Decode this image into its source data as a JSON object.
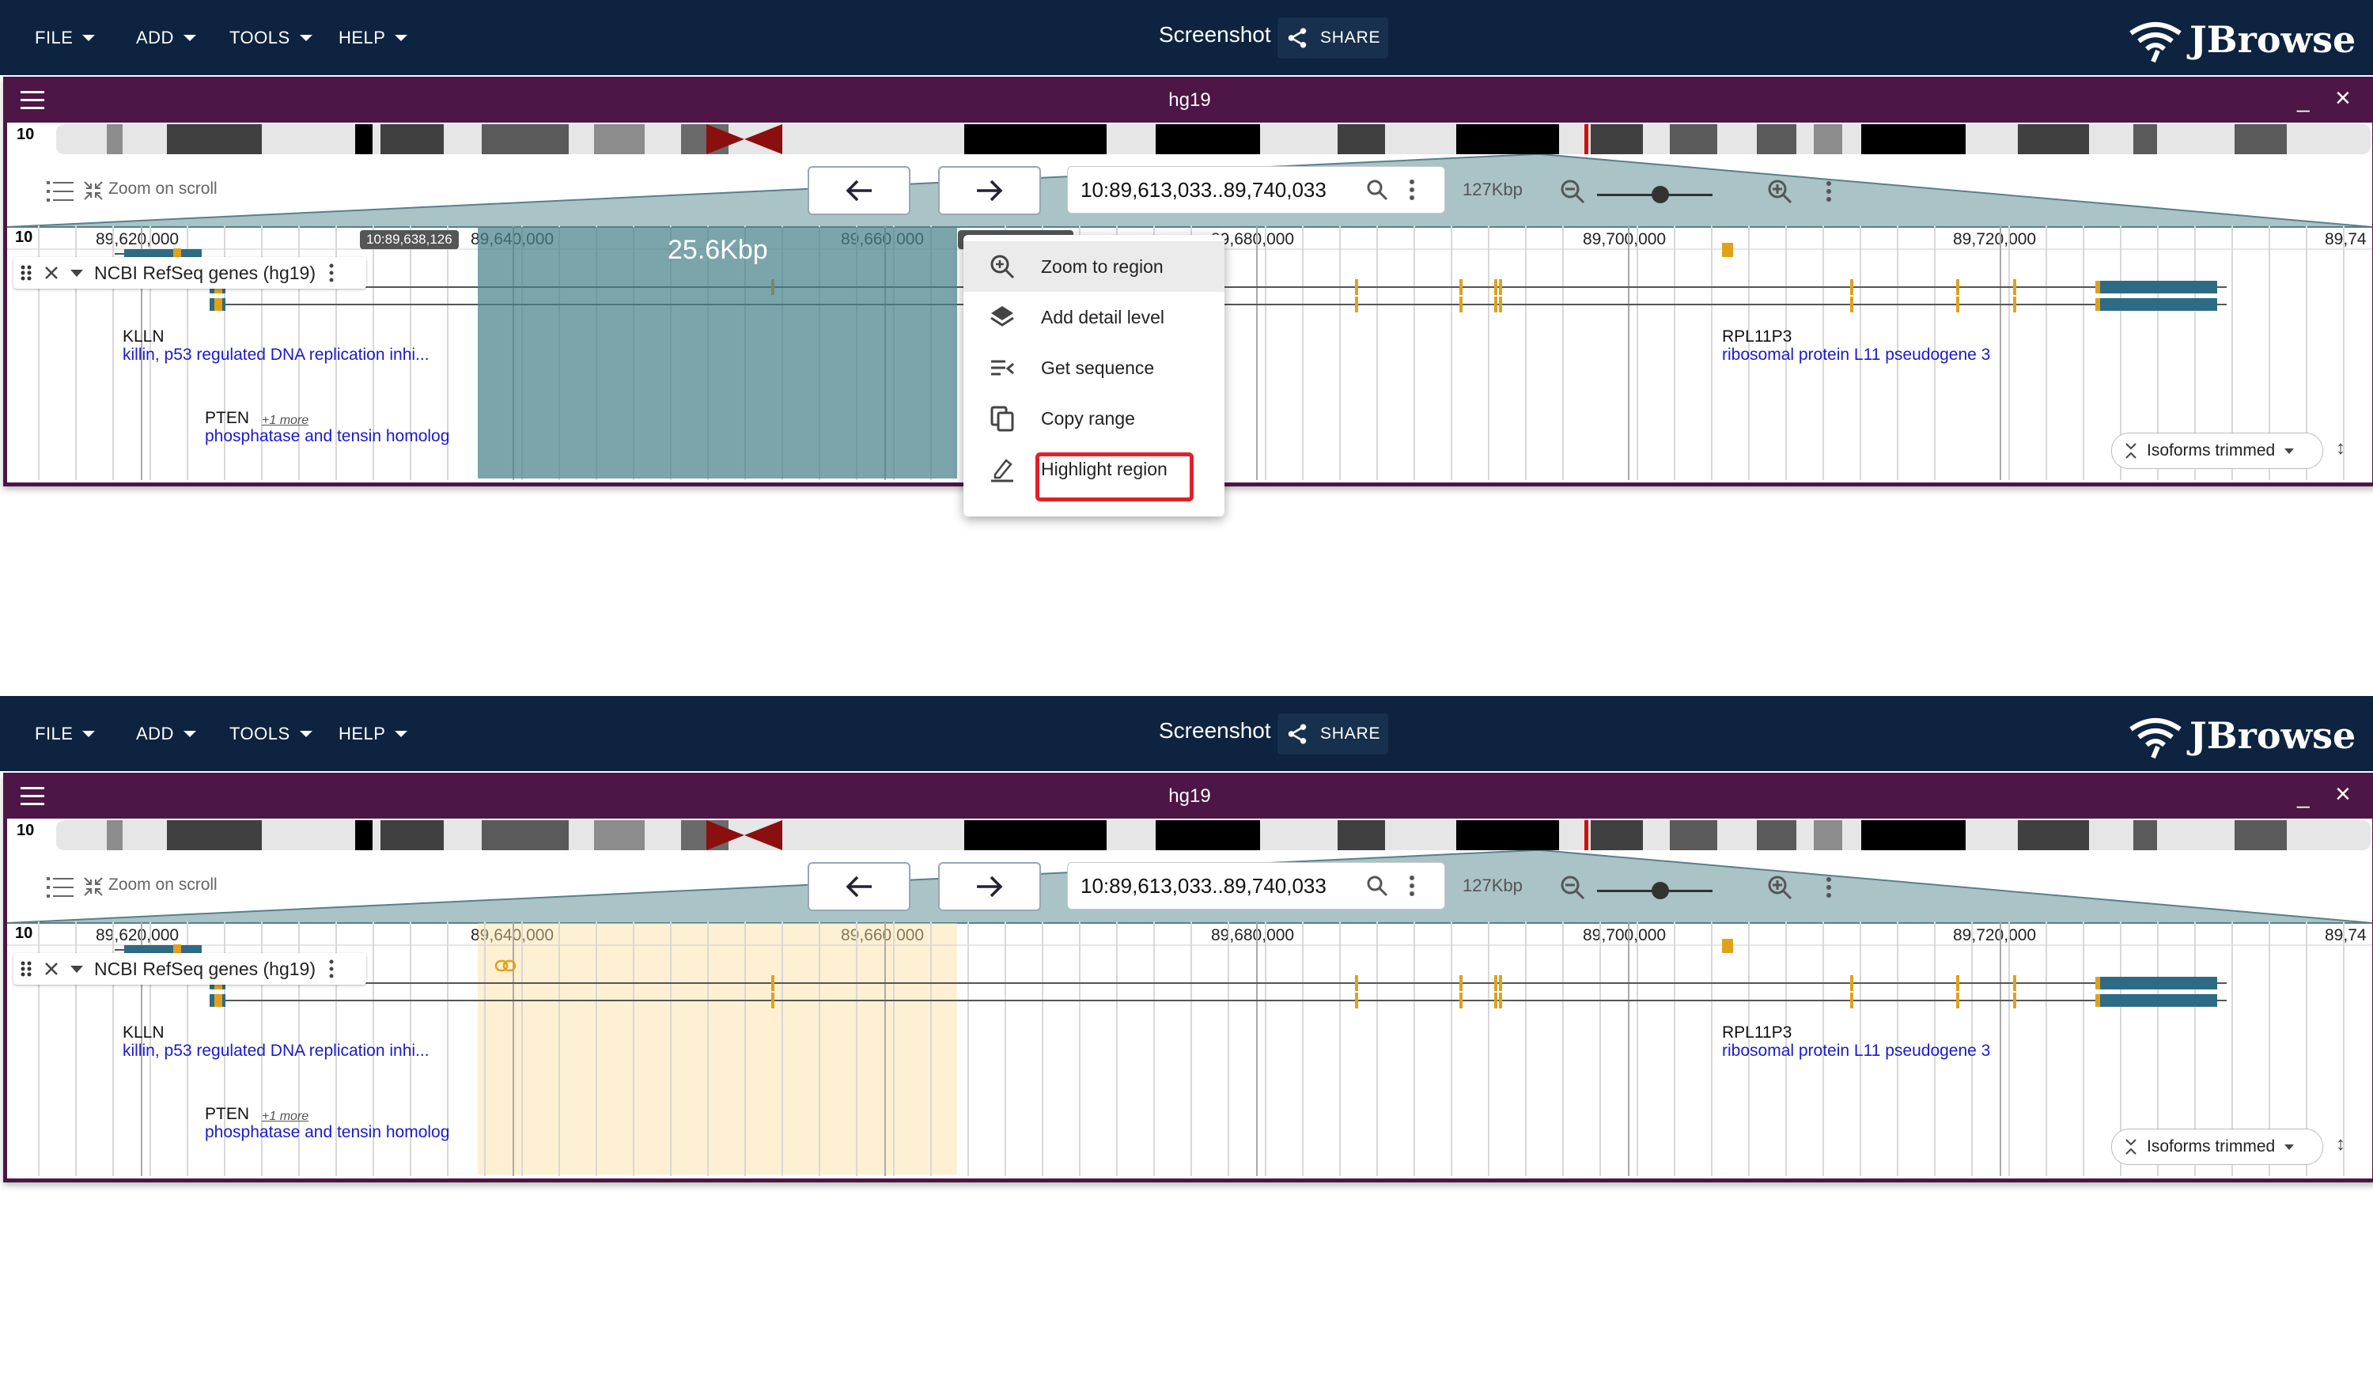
{
  "menus": [
    {
      "label": "FILE"
    },
    {
      "label": "ADD"
    },
    {
      "label": "TOOLS"
    },
    {
      "label": "HELP"
    }
  ],
  "header": {
    "screenshot_label": "Screenshot",
    "share_label": "SHARE",
    "logo_text": "JBrowse"
  },
  "view": {
    "assembly_title": "hg19",
    "chromosome": "10",
    "zoom_on_scroll_label": "Zoom on scroll",
    "locstring": "10:89,613,033..89,740,033",
    "bp_per_view": "127Kbp",
    "ruler_chrom": "10",
    "ruler_ticks": [
      "89,620,000",
      "89,640,000",
      "89,660,000",
      "89,680,000",
      "89,700,000",
      "89,720,000",
      "89,74"
    ],
    "track_name": "NCBI RefSeq genes (hg19)",
    "isoforms_button": "Isoforms trimmed",
    "slider_level": 0.55
  },
  "genes": [
    {
      "name": "KLLN",
      "description": "killin, p53 regulated DNA replication inhi..."
    },
    {
      "name": "PTEN",
      "description": "phosphatase and tensin homolog",
      "more": "+1 more"
    },
    {
      "name": "RPL11P3",
      "description": "ribosomal protein L11 pseudogene 3"
    }
  ],
  "selection": {
    "size_label": "25.6Kbp",
    "start_tag": "10:89,638,126"
  },
  "context_menu": {
    "items": [
      {
        "label": "Zoom to region",
        "icon": "zoom-in-icon"
      },
      {
        "label": "Add detail level",
        "icon": "layers-icon"
      },
      {
        "label": "Get sequence",
        "icon": "sequence-icon"
      },
      {
        "label": "Copy range",
        "icon": "copy-icon"
      },
      {
        "label": "Highlight region",
        "icon": "highlight-pen-icon"
      }
    ]
  },
  "colors": {
    "appbar": "#0d233f",
    "view_header": "#4d1646",
    "selection": "#6e9ea4",
    "highlight": "#fddd9e",
    "gene_feature": "#2e6b85",
    "exon_accent": "#e0a21b",
    "callout": "#e0202a"
  }
}
